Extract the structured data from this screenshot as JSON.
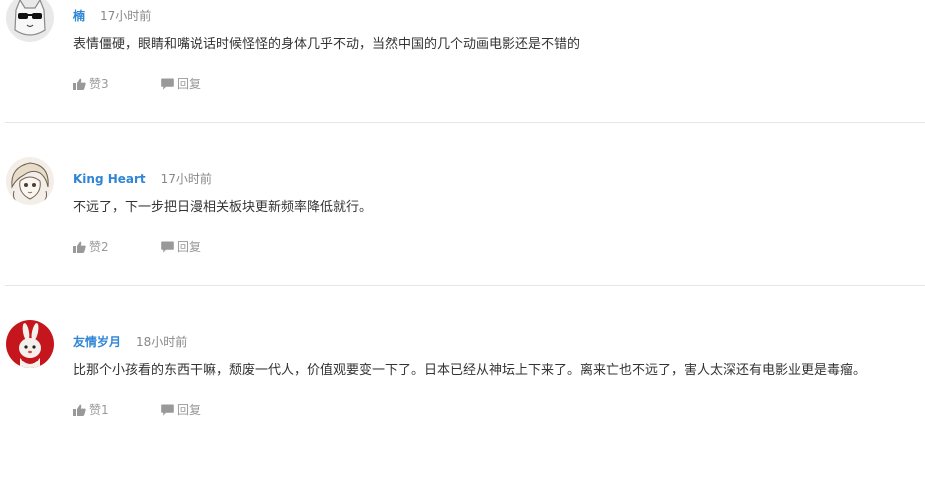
{
  "comments": [
    {
      "username": "楠",
      "time": "17小时前",
      "content": "表情僵硬，眼睛和嘴说话时候怪怪的身体几乎不动，当然中国的几个动画电影还是不错的",
      "likes_label": "赞3",
      "reply_label": "回复",
      "avatar_icon": "sunglasses-cat-avatar"
    },
    {
      "username": "King Heart",
      "time": "17小时前",
      "content": "不远了，下一步把日漫相关板块更新频率降低就行。",
      "likes_label": "赞2",
      "reply_label": "回复",
      "avatar_icon": "anime-sketch-avatar"
    },
    {
      "username": "友情岁月",
      "time": "18小时前",
      "content": "比那个小孩看的东西干嘛，颓废一代人，价值观要变一下了。日本已经从神坛上下来了。离来亡也不远了，害人太深还有电影业更是毒瘤。",
      "likes_label": "赞1",
      "reply_label": "回复",
      "avatar_icon": "red-rabbit-avatar"
    }
  ],
  "icons": {
    "like": "thumbs-up-icon",
    "reply": "speech-bubble-icon"
  },
  "colors": {
    "username": "#2f85d6",
    "meta": "#888888",
    "action": "#999999",
    "divider": "#e5e5e5"
  }
}
